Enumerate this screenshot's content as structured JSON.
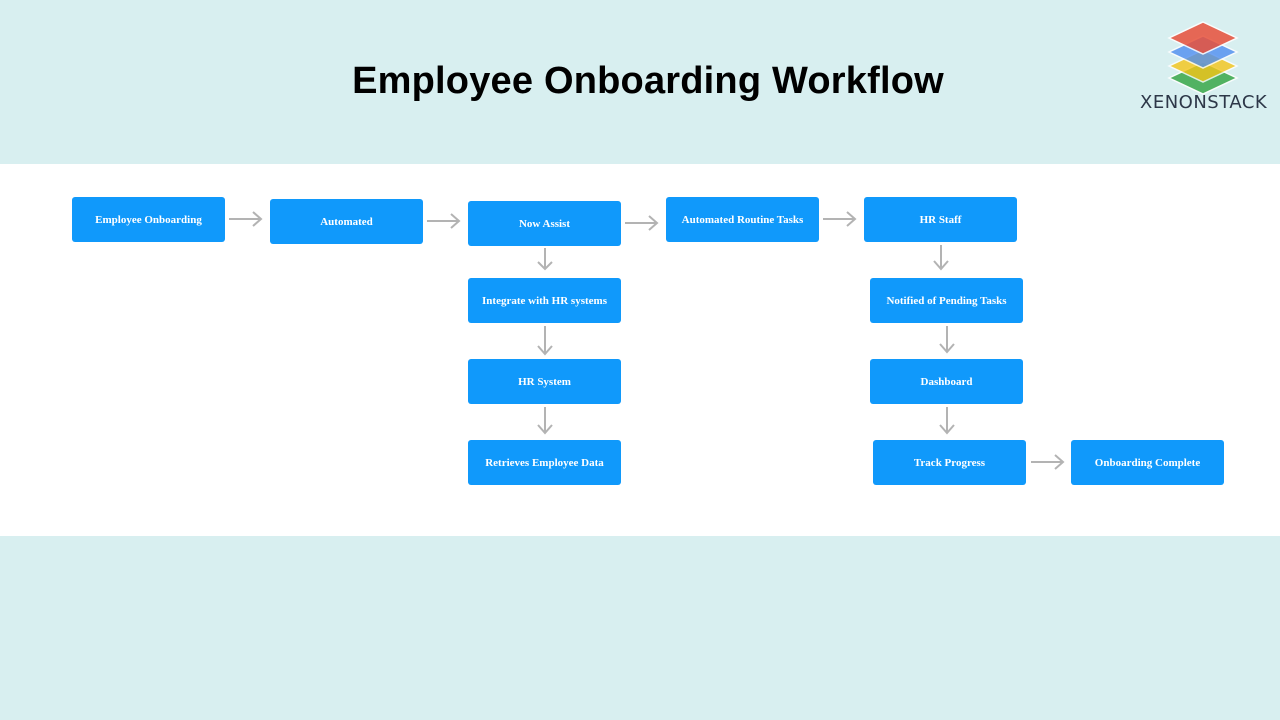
{
  "header": {
    "title": "Employee Onboarding Workflow",
    "logo_text": "XENONSTACK",
    "logo_icon": "stacked-layers-icon"
  },
  "colors": {
    "background": "#d8eff0",
    "canvas": "#ffffff",
    "node_fill": "#1099fb",
    "node_text": "#ffffff",
    "arrow": "#b3b3b3"
  },
  "diagram": {
    "nodes": [
      {
        "id": "n1",
        "label": "Employee Onboarding"
      },
      {
        "id": "n2",
        "label": "Automated"
      },
      {
        "id": "n3",
        "label": "Now Assist"
      },
      {
        "id": "n4",
        "label": "Automated Routine Tasks"
      },
      {
        "id": "n5",
        "label": "HR Staff"
      },
      {
        "id": "n6",
        "label": "Integrate with HR systems"
      },
      {
        "id": "n7",
        "label": "HR System"
      },
      {
        "id": "n8",
        "label": "Retrieves Employee Data"
      },
      {
        "id": "n9",
        "label": "Notified of Pending Tasks"
      },
      {
        "id": "n10",
        "label": "Dashboard"
      },
      {
        "id": "n11",
        "label": "Track Progress"
      },
      {
        "id": "n12",
        "label": "Onboarding Complete"
      }
    ],
    "edges": [
      {
        "from": "n1",
        "to": "n2"
      },
      {
        "from": "n2",
        "to": "n3"
      },
      {
        "from": "n3",
        "to": "n4"
      },
      {
        "from": "n4",
        "to": "n5"
      },
      {
        "from": "n3",
        "to": "n6"
      },
      {
        "from": "n6",
        "to": "n7"
      },
      {
        "from": "n7",
        "to": "n8"
      },
      {
        "from": "n5",
        "to": "n9"
      },
      {
        "from": "n9",
        "to": "n10"
      },
      {
        "from": "n10",
        "to": "n11"
      },
      {
        "from": "n11",
        "to": "n12"
      }
    ]
  }
}
